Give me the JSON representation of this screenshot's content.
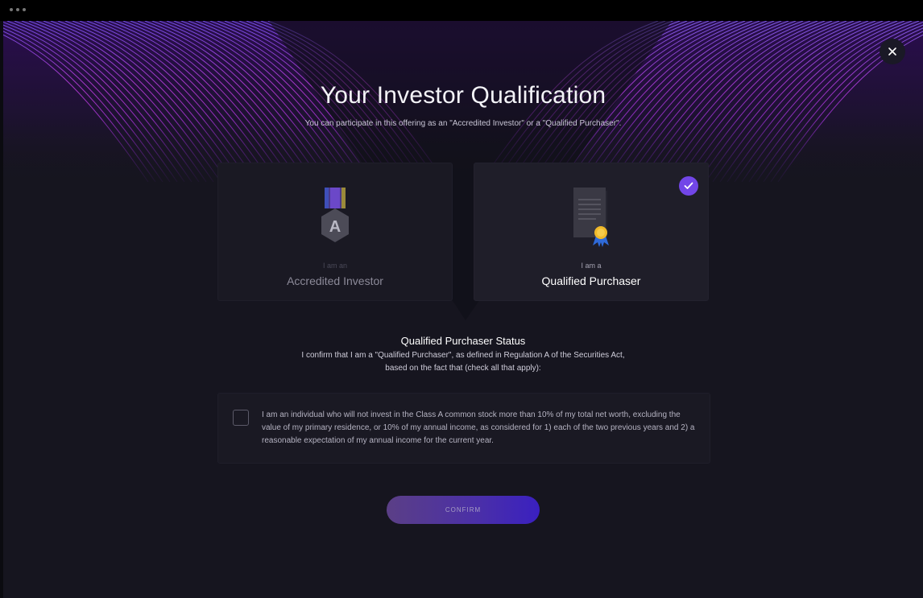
{
  "window": {
    "controls": [
      "window-dot",
      "window-dot",
      "window-dot"
    ]
  },
  "header": {
    "title": "Your Investor Qualification",
    "subtitle": "You can participate in this offering as an \"Accredited Investor\" or a \"Qualified Purchaser\".",
    "close_icon": "close-icon"
  },
  "options": {
    "accredited": {
      "pre_label": "I am an",
      "label": "Accredited Investor",
      "icon": "medal-icon",
      "selected": false
    },
    "qualified": {
      "pre_label": "I am a",
      "label": "Qualified Purchaser",
      "icon": "certificate-icon",
      "selected": true,
      "badge_icon": "checkmark-icon"
    }
  },
  "status": {
    "title": "Qualified Purchaser Status",
    "description_line1": "I confirm that I am a \"Qualified Purchaser\", as defined in Regulation A of the Securities Act,",
    "description_line2": "based on the fact that (check all that apply):"
  },
  "criteria": [
    {
      "text": "I am an individual who will not invest in the Class A common stock more than 10% of my total net worth, excluding the value of my primary residence, or 10% of my annual income, as considered for 1) each of the two previous years and 2) a reasonable expectation of my annual income for the current year.",
      "checked": false
    }
  ],
  "actions": {
    "confirm_label": "CONFIRM"
  },
  "colors": {
    "background": "#16151f",
    "accent": "#7246e8",
    "hero_purple": "#8a2bd6",
    "confirm_gradient_start": "#5b3f86",
    "confirm_gradient_end": "#3a20c0"
  }
}
